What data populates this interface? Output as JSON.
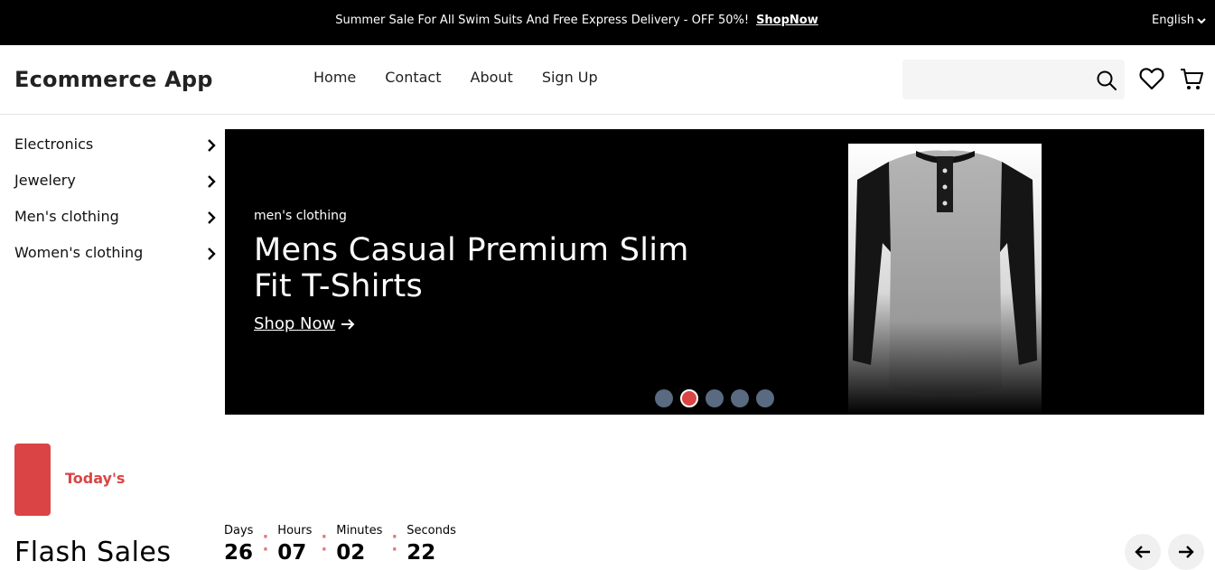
{
  "topbar": {
    "promo_text": "Summer Sale For All Swim Suits And Free Express Delivery - OFF 50%!",
    "promo_link": "ShopNow",
    "language": "English"
  },
  "header": {
    "logo": "Ecommerce App",
    "nav": [
      "Home",
      "Contact",
      "About",
      "Sign Up"
    ],
    "search_placeholder": ""
  },
  "sidebar": {
    "categories": [
      "Electronics",
      "Jewelery",
      "Men's clothing",
      "Women's clothing"
    ]
  },
  "hero": {
    "category": "men's clothing",
    "title": "Mens Casual Premium Slim Fit T-Shirts",
    "cta": "Shop Now",
    "slides_count": 5,
    "active_slide": 2
  },
  "flash": {
    "tag": "Today's",
    "title": "Flash Sales",
    "timer": [
      {
        "label": "Days",
        "value": "26"
      },
      {
        "label": "Hours",
        "value": "07"
      },
      {
        "label": "Minutes",
        "value": "02"
      },
      {
        "label": "Seconds",
        "value": "22"
      }
    ]
  },
  "colors": {
    "accent": "#db4444",
    "topbar_bg": "#000000",
    "dot_inactive": "#5a6a80"
  },
  "icons": [
    "chevron-down-icon",
    "search-icon",
    "heart-icon",
    "cart-icon",
    "chevron-right-icon",
    "arrow-right-icon",
    "arrow-left-icon"
  ]
}
